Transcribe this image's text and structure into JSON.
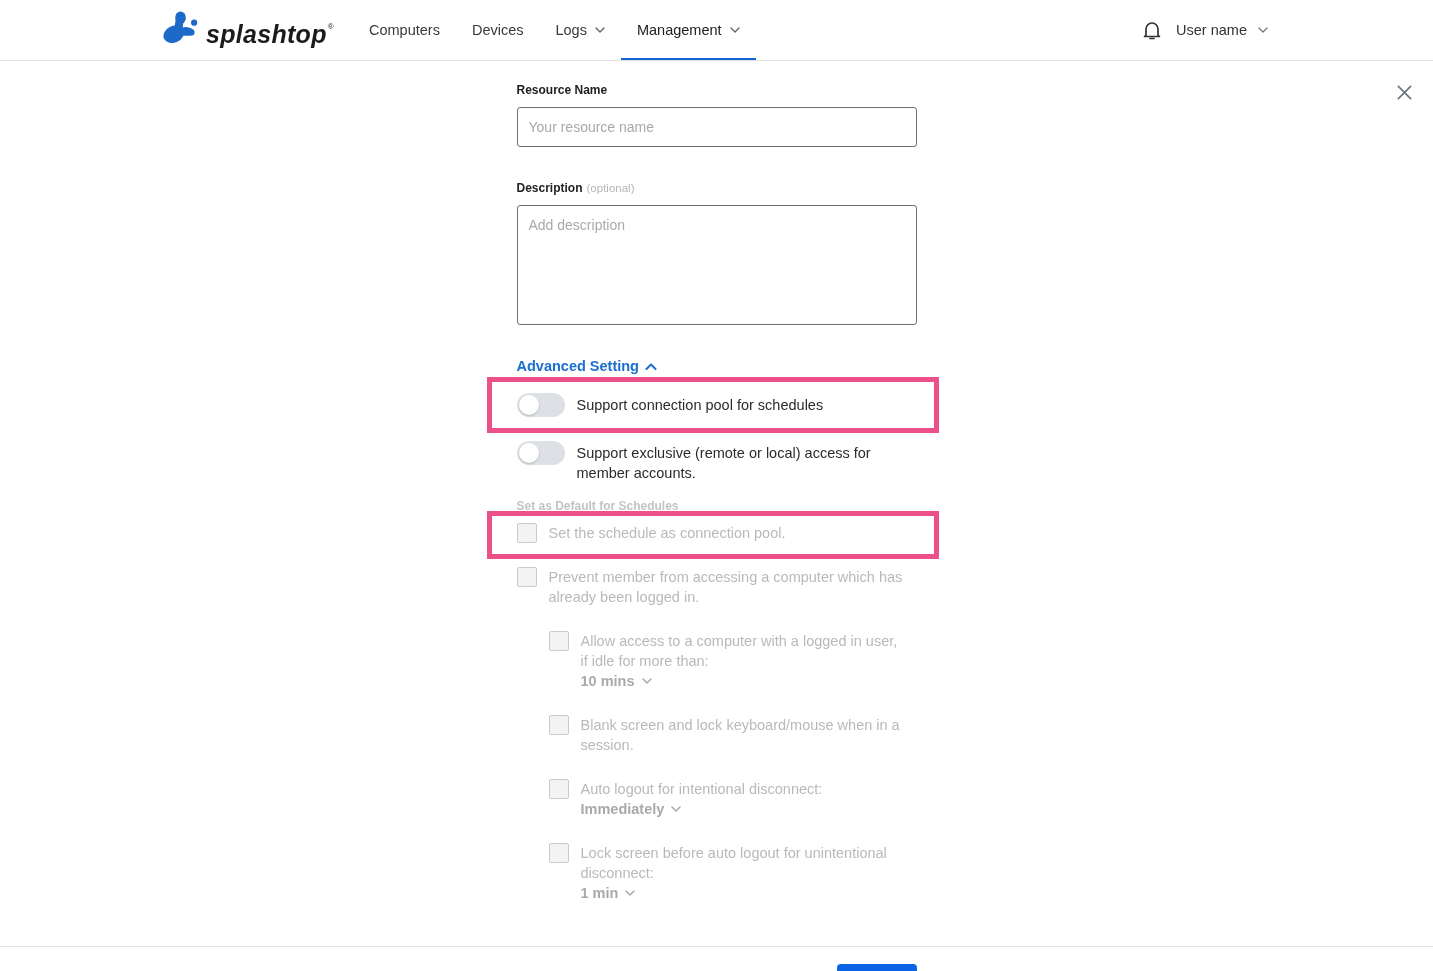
{
  "header": {
    "logo": "splashtop$^{®}$",
    "nav": [
      {
        "label": "Computers",
        "selected": false,
        "dropdown": false
      },
      {
        "label": "Devices",
        "selected": false,
        "dropdown": false
      },
      {
        "label": "Logs",
        "selected": false,
        "dropdown": true
      },
      {
        "label": "Management",
        "selected": true,
        "dropdown": true
      }
    ],
    "user_name": "User name"
  },
  "form": {
    "resource_name": {
      "label": "Resource Name",
      "placeholder": "Your resource name"
    },
    "description": {
      "label": "Description",
      "hint": "(optional)",
      "placeholder": "Add description"
    },
    "advanced": {
      "label": "Advanced Setting",
      "expanded": true,
      "toggles": [
        {
          "label": "Support connection pool for schedules",
          "on": false,
          "highlighted": true
        },
        {
          "label": "Support exclusive (remote or local) access for member accounts.",
          "on": false,
          "highlighted": false
        }
      ],
      "defaults": {
        "title": "Set as Default for Schedules",
        "disabled": true,
        "options": [
          {
            "label": "Set the schedule as connection pool.",
            "checked": false,
            "highlighted": true
          },
          {
            "label": "Prevent member from accessing a computer which has already been logged in.",
            "checked": false,
            "highlighted": false,
            "children": [
              {
                "label": "Allow access to a computer with a logged in user, if idle for more than:",
                "value": "10 mins",
                "checked": false
              },
              {
                "label": "Blank screen and lock keyboard/mouse when in a session.",
                "checked": false
              },
              {
                "label": "Auto logout for intentional disconnect:",
                "value": "Immediately",
                "checked": false
              },
              {
                "label": "Lock screen before auto logout for unintentional disconnect:",
                "value": "1 min",
                "checked": false
              }
            ]
          }
        ]
      }
    }
  }
}
